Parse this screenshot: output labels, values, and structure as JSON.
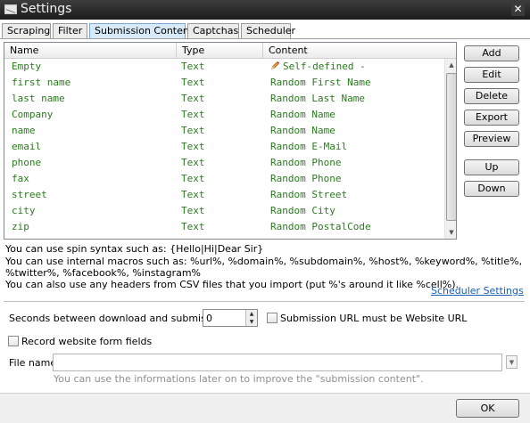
{
  "window": {
    "title": "Settings",
    "close_glyph": "✕"
  },
  "tabs": [
    {
      "label": "Scraping"
    },
    {
      "label": "Filter"
    },
    {
      "label": "Submission Content"
    },
    {
      "label": "Captchas"
    },
    {
      "label": "Scheduler"
    }
  ],
  "active_tab": "Submission Content",
  "grid": {
    "columns": [
      "Name",
      "Type",
      "Content"
    ],
    "rows": [
      {
        "name": "Empty",
        "type": "Text",
        "content": "Self-defined -",
        "icon": "pencil-icon"
      },
      {
        "name": "first name",
        "type": "Text",
        "content": "Random First Name"
      },
      {
        "name": "last name",
        "type": "Text",
        "content": "Random Last Name"
      },
      {
        "name": "Company",
        "type": "Text",
        "content": "Random Name"
      },
      {
        "name": "name",
        "type": "Text",
        "content": "Random Name"
      },
      {
        "name": "email",
        "type": "Text",
        "content": "Random E-Mail"
      },
      {
        "name": "phone",
        "type": "Text",
        "content": "Random Phone"
      },
      {
        "name": "fax",
        "type": "Text",
        "content": "Random Phone"
      },
      {
        "name": "street",
        "type": "Text",
        "content": "Random Street"
      },
      {
        "name": "city",
        "type": "Text",
        "content": "Random City"
      },
      {
        "name": "zip",
        "type": "Text",
        "content": "Random PostalCode"
      }
    ],
    "text_color": "#2b7a1f"
  },
  "side_buttons": {
    "add": "Add",
    "edit": "Edit",
    "delete": "Delete",
    "export": "Export",
    "preview": "Preview",
    "up": "Up",
    "down": "Down"
  },
  "info": {
    "line1": "You can use spin syntax such as: {Hello|Hi|Dear Sir}",
    "line2": "You can use internal macros such as: %url%, %domain%, %subdomain%, %host%, %keyword%, %title%,",
    "line3": "%twitter%, %facebook%, %instagram%",
    "line4": "You can also use any headers from CSV files that you import (put %'s around it like %cell%)."
  },
  "scheduler_link": "Scheduler Settings",
  "form": {
    "seconds_label": "Seconds between download and submission",
    "seconds_value": "0",
    "submission_url_label": "Submission URL must be Website URL",
    "record_label": "Record website form fields",
    "file_name_label": "File name",
    "file_name_value": "",
    "hint": "You can use the informations later on to improve the \"submission content\"."
  },
  "ok_label": "OK"
}
